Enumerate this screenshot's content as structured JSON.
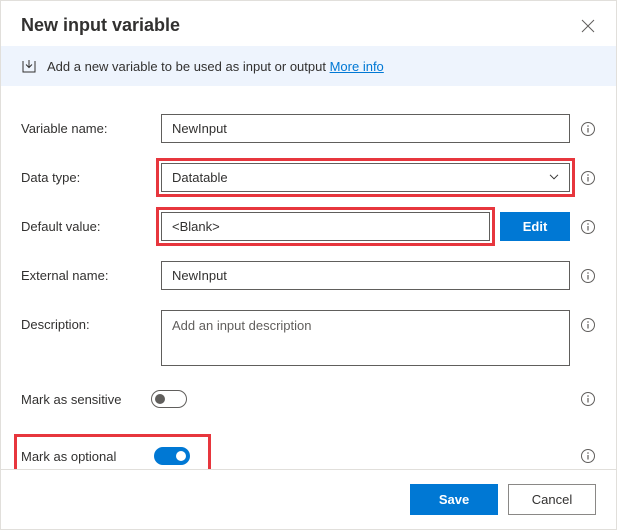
{
  "header": {
    "title": "New input variable"
  },
  "banner": {
    "text": "Add a new variable to be used as input or output ",
    "link_label": "More info"
  },
  "labels": {
    "variable_name": "Variable name:",
    "data_type": "Data type:",
    "default_value": "Default value:",
    "external_name": "External name:",
    "description": "Description:",
    "mark_sensitive": "Mark as sensitive",
    "mark_optional": "Mark as optional"
  },
  "fields": {
    "variable_name": "NewInput",
    "data_type": "Datatable",
    "default_value": "<Blank>",
    "external_name": "NewInput",
    "description_placeholder": "Add an input description"
  },
  "buttons": {
    "edit": "Edit",
    "save": "Save",
    "cancel": "Cancel"
  },
  "toggles": {
    "sensitive_on": false,
    "optional_on": true
  }
}
